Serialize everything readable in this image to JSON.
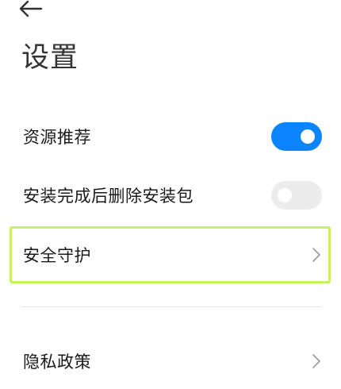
{
  "header": {
    "back_icon": "arrow-left-icon",
    "title": "设置"
  },
  "settings": {
    "resource_recommend": {
      "label": "资源推荐",
      "toggle_on": true
    },
    "delete_package": {
      "label": "安装完成后删除安装包",
      "toggle_on": false
    },
    "security": {
      "label": "安全守护",
      "icon": "chevron-right-icon"
    },
    "privacy": {
      "label": "隐私政策",
      "icon": "chevron-right-icon"
    }
  },
  "colors": {
    "toggle_on": "#0d84ff",
    "toggle_off": "#ececec",
    "highlight": "#c6f25e"
  }
}
